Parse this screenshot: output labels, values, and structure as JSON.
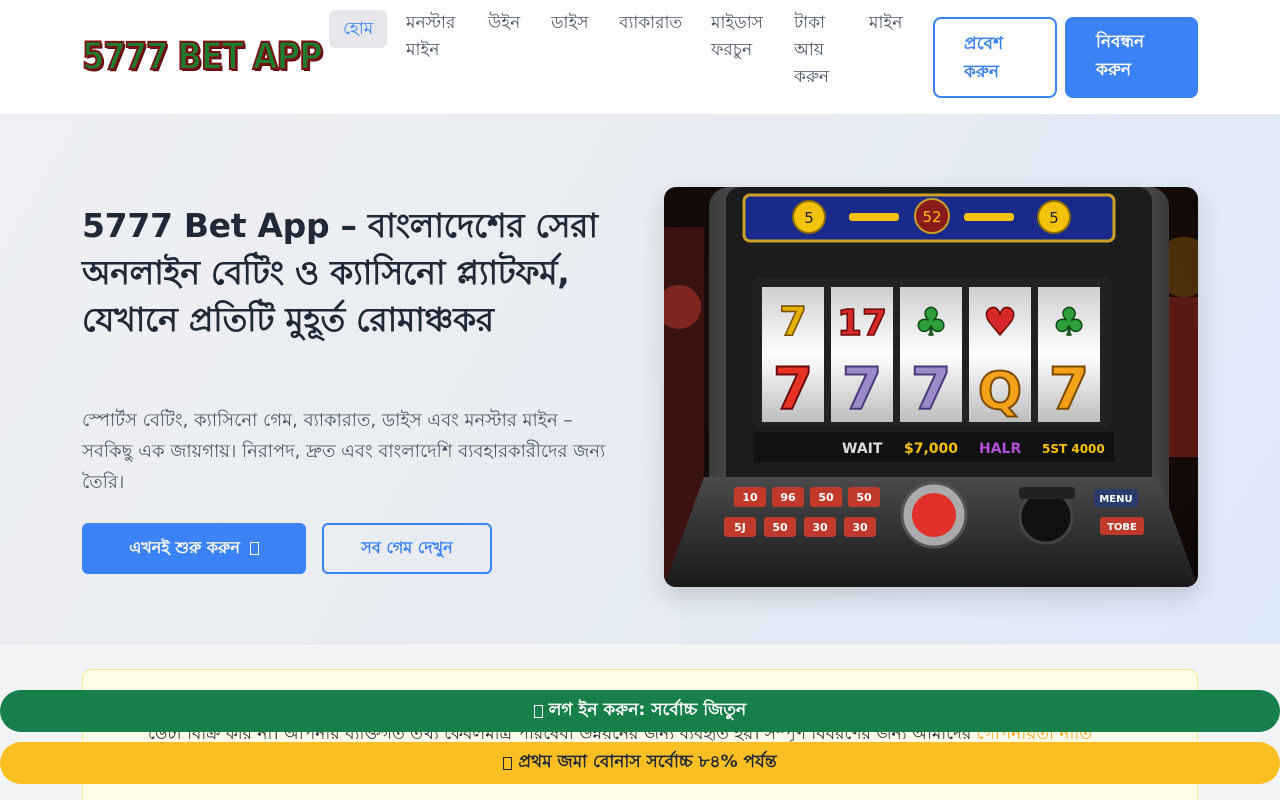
{
  "header": {
    "logo_text": "5777 BET APP",
    "nav": [
      {
        "label": "হোম",
        "active": true
      },
      {
        "label": "মনস্টার মাইন",
        "active": false
      },
      {
        "label": "উইন",
        "active": false
      },
      {
        "label": "ডাইস",
        "active": false
      },
      {
        "label": "ব্যাকারাত",
        "active": false
      },
      {
        "label": "মাইডাস ফরচুন",
        "active": false
      },
      {
        "label": "টাকা আয় করুন",
        "active": false
      },
      {
        "label": "মাইন",
        "active": false
      }
    ],
    "login_label": "প্রবেশ করুন",
    "register_label": "নিবন্ধন করুন"
  },
  "hero": {
    "title": "5777 Bet App – বাংলাদেশের সেরা অনলাইন বেটিং ও ক্যাসিনো প্ল্যাটফর্ম, যেখানে প্রতিটি মুহূর্ত রোমাঞ্চকর",
    "description": "স্পোর্টস বেটিং, ক্যাসিনো গেম, ব্যাকারাত, ডাইস এবং মনস্টার মাইন – সবকিছু এক জায়গায়। নিরাপদ, দ্রুত এবং বাংলাদেশি ব্যবহারকারীদের জন্য তৈরি।",
    "start_label": "এখনই শুরু করুন",
    "games_label": "সব গেম দেখুন",
    "image": {
      "top_display": [
        "5",
        "52",
        "5"
      ],
      "reels_top": [
        "7",
        "17",
        "♣",
        "♥",
        "♣"
      ],
      "reels_bottom": [
        "7",
        "7",
        "7",
        "Q",
        "7"
      ],
      "status": [
        "WAIT",
        "$7,000",
        "HALR",
        "5ST 4000"
      ],
      "buttons_left": [
        "10",
        "96",
        "50",
        "50",
        "5J",
        "50",
        "30",
        "30"
      ],
      "buttons_right": [
        "MENU",
        "TOBE"
      ]
    }
  },
  "notice": {
    "text_before": "ডেটা বিক্রি করি না। আপনার ব্যক্তিগত তথ্য কেবলমাত্র পরিষেবা উন্নয়নের জন্য ব্যবহৃত হয়। সম্পূর্ণ বিবরণের জন্য আমাদের ",
    "link_label": "গোপনীয়তা নীতি"
  },
  "banners": {
    "green_label": "লগ ইন করুন: সর্বোচ্চ জিতুন",
    "yellow_label": "প্রথম জমা বোনাস সর্বোচ্চ ৮৪% পর্যন্ত"
  }
}
